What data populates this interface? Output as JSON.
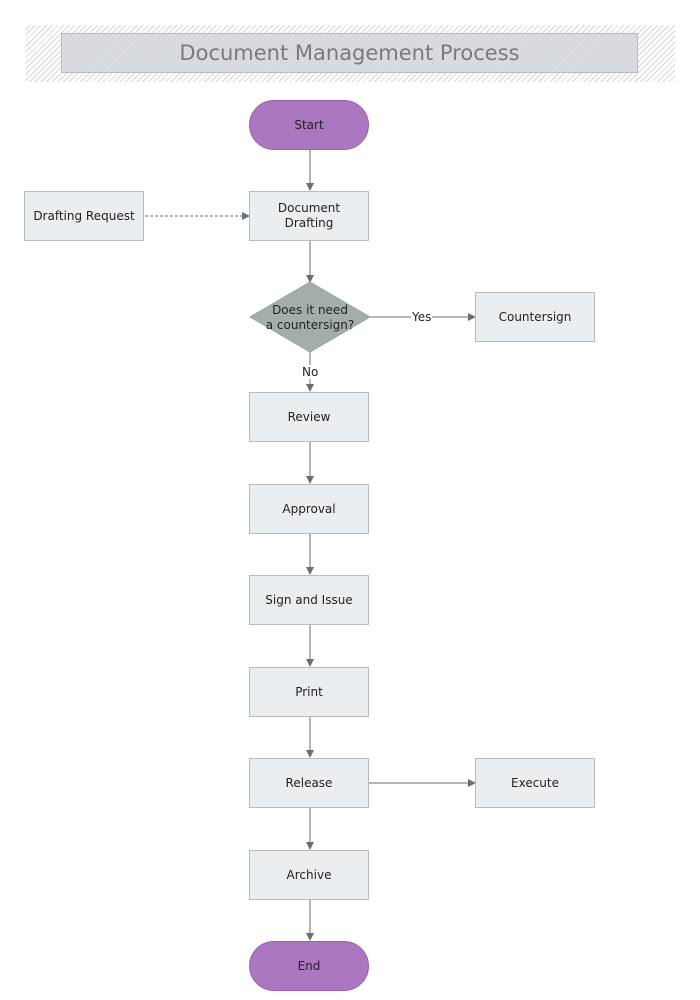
{
  "title": "Document Management Process",
  "nodes": {
    "start": "Start",
    "drafting_request": "Drafting Request",
    "document_drafting": "Document\nDrafting",
    "decision": "Does it need\na countersign?",
    "countersign": "Countersign",
    "review": "Review",
    "approval": "Approval",
    "sign_issue": "Sign and Issue",
    "print": "Print",
    "release": "Release",
    "execute": "Execute",
    "archive": "Archive",
    "end": "End"
  },
  "edge_labels": {
    "yes": "Yes",
    "no": "No"
  },
  "colors": {
    "terminal": "#ab77c1",
    "process": "#ebeef0",
    "decision": "#a3aeab",
    "connector": "#6e6e6e"
  }
}
